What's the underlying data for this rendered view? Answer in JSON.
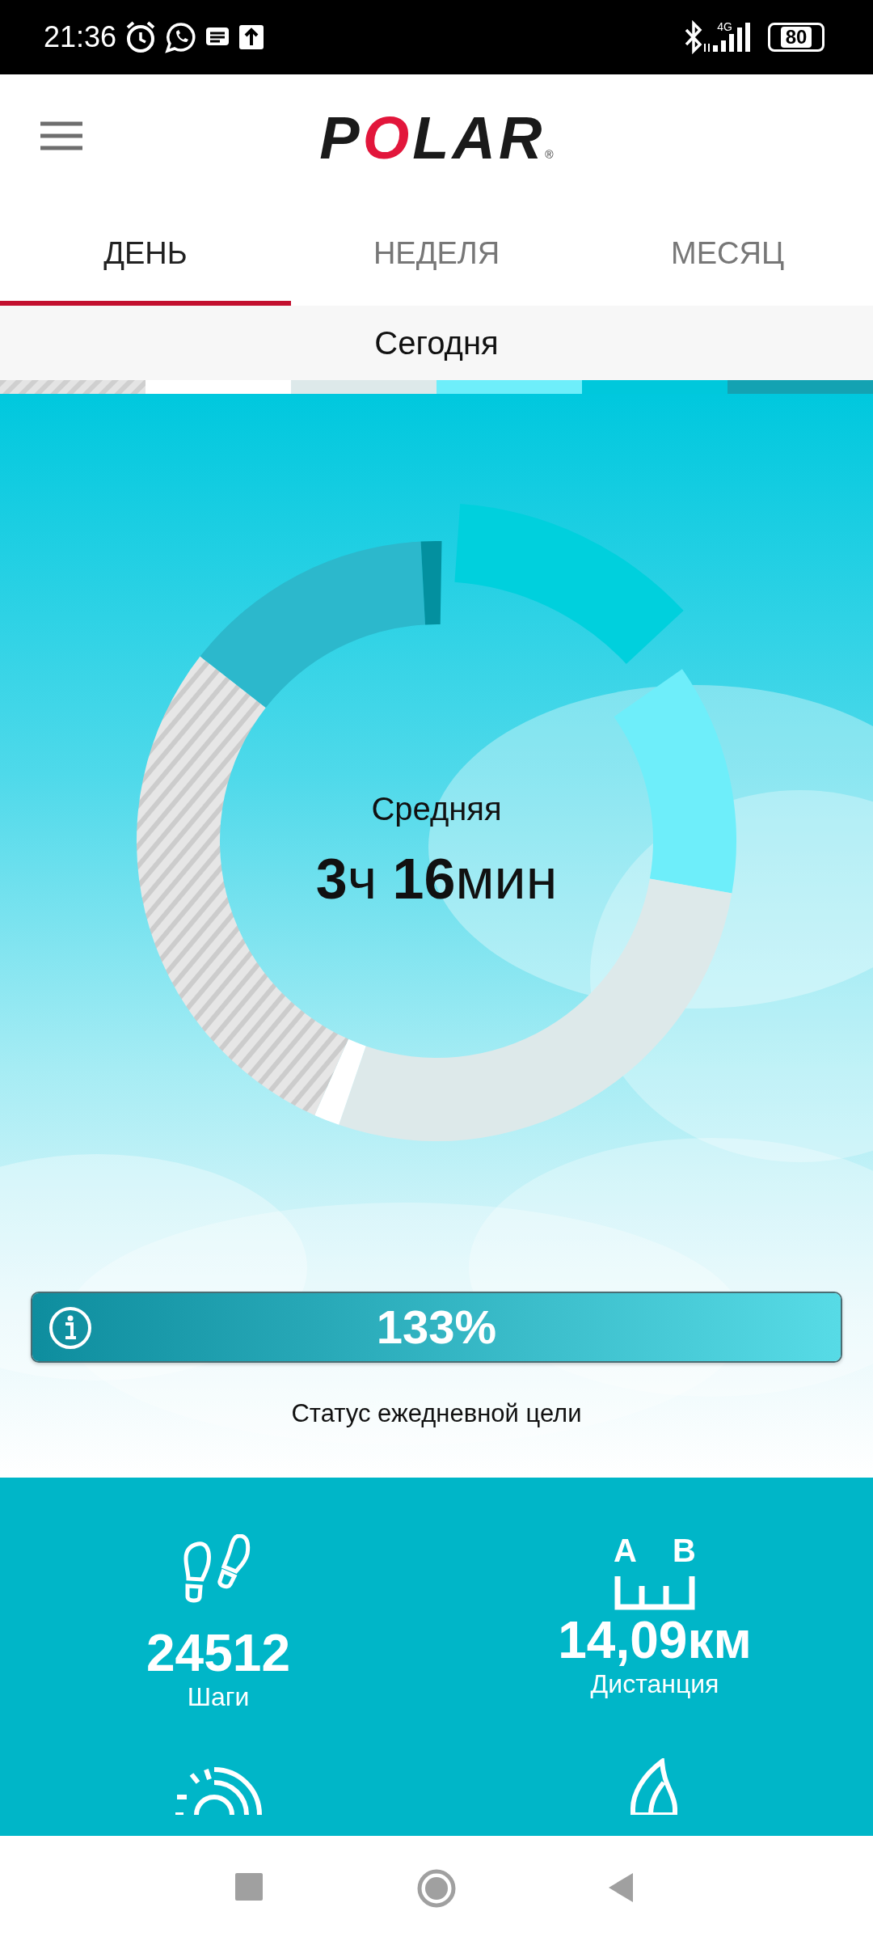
{
  "status_bar": {
    "time": "21:36",
    "network": "4G",
    "battery": "80"
  },
  "header": {
    "logo": "POLAR",
    "logo_mark": "®"
  },
  "tabs": [
    {
      "label": "ДЕНЬ",
      "selected": true
    },
    {
      "label": "НЕДЕЛЯ",
      "selected": false
    },
    {
      "label": "МЕСЯЦ",
      "selected": false
    }
  ],
  "date_label": "Сегодня",
  "ring": {
    "label": "Средняя",
    "value": "**3**ч **16**мин"
  },
  "goal": {
    "percent": "133%",
    "level": 1,
    "caption": "Статус ежедневной цели"
  },
  "stats": [
    {
      "kind": "steps",
      "value": "24512",
      "label": "Шаги"
    },
    {
      "kind": "distance",
      "icon_letters": [
        "A",
        "B"
      ],
      "value": "**14,09**км",
      "label": "Дистанция"
    },
    {
      "kind": "sun"
    },
    {
      "kind": "flame"
    }
  ]
}
